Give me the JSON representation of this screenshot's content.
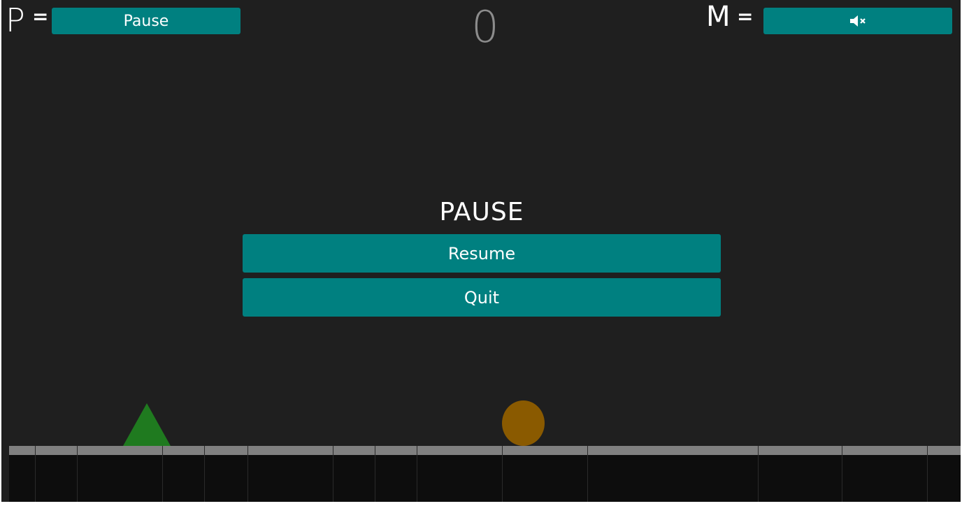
{
  "hud": {
    "pause_key": "P",
    "pause_eq": "=",
    "pause_label": "Pause",
    "mute_key": "M",
    "mute_eq": "=",
    "mute_icon": "speaker-muted-icon",
    "score": "0"
  },
  "pause_menu": {
    "title": "PAUSE",
    "resume_label": "Resume",
    "quit_label": "Quit"
  },
  "colors": {
    "background": "#1f1f1f",
    "button": "#008080",
    "player": "#1f7a1f",
    "obstacle": "#8a5a00",
    "ground_top": "#808080",
    "ground_bottom": "#0d0d0d"
  }
}
